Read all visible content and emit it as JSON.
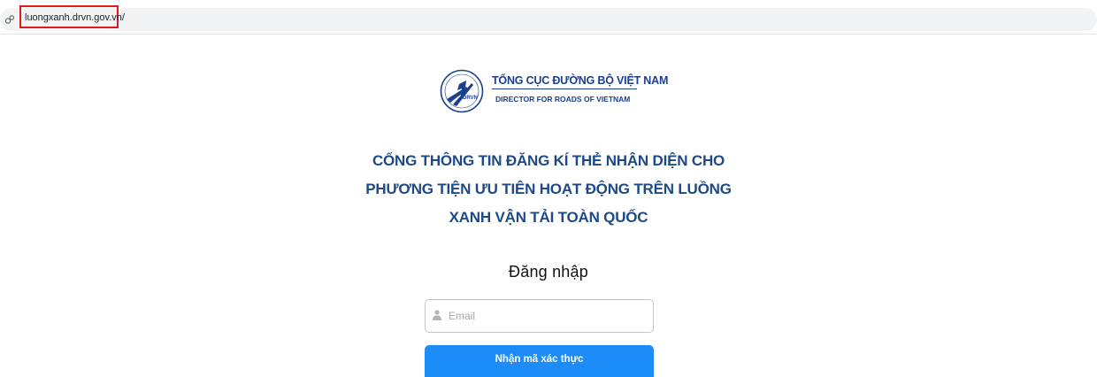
{
  "browser": {
    "url": "luongxanh.drvn.gov.vn/",
    "site_info_icon": "site-info-icon",
    "highlight_color": "#e0191f"
  },
  "logo": {
    "emblem_text": "DRVN",
    "title": "TỔNG CỤC ĐƯỜNG BỘ VIỆT NAM",
    "subtitle": "DIRECTOR FOR ROADS OF VIETNAM",
    "color": "#1b3f8f"
  },
  "portal": {
    "heading_lines": [
      "CỔNG THÔNG TIN ĐĂNG KÍ THẺ NHẬN DIỆN CHO",
      "PHƯƠNG TIỆN ƯU TIÊN HOẠT ĐỘNG TRÊN LUỒNG",
      "XANH VẬN TẢI TOÀN QUỐC"
    ],
    "heading_color": "#1d4a86"
  },
  "login": {
    "title": "Đăng nhập",
    "email_placeholder": "Email",
    "email_value": "",
    "email_icon": "user-icon",
    "submit_label": "Nhận mã xác thực",
    "button_color": "#1d8cf8"
  }
}
